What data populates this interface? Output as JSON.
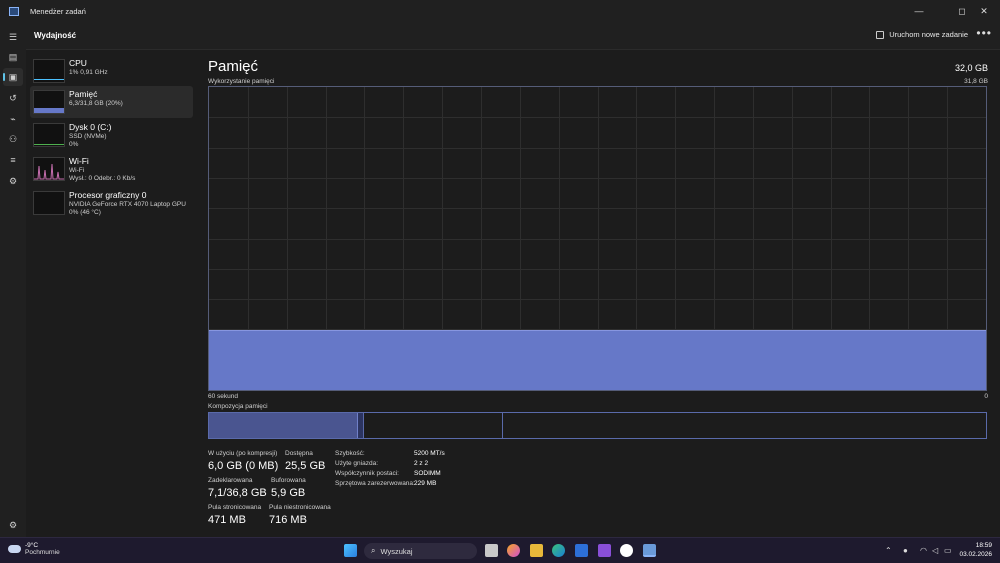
{
  "window": {
    "title": "Menedżer zadań",
    "controls": {
      "minimize": "—",
      "maximize": "◻",
      "close": "✕"
    }
  },
  "header": {
    "page_title": "Wydajność",
    "run_task_label": "Uruchom nowe zadanie",
    "more_label": "•••"
  },
  "nav": {
    "items": [
      {
        "icon": "hamburger-icon",
        "glyph": "☰"
      },
      {
        "icon": "processes-icon",
        "glyph": "▤"
      },
      {
        "icon": "performance-icon",
        "glyph": "▣"
      },
      {
        "icon": "app-history-icon",
        "glyph": "↺"
      },
      {
        "icon": "startup-apps-icon",
        "glyph": "⌁"
      },
      {
        "icon": "users-icon",
        "glyph": "⚇"
      },
      {
        "icon": "details-icon",
        "glyph": "≡"
      },
      {
        "icon": "services-icon",
        "glyph": "⚙"
      }
    ],
    "settings_glyph": "⚙"
  },
  "sidebar": {
    "items": [
      {
        "name": "CPU",
        "sub1": "1% 0,91 GHz",
        "sub2": ""
      },
      {
        "name": "Pamięć",
        "sub1": "6,3/31,8 GB (20%)",
        "sub2": ""
      },
      {
        "name": "Dysk 0 (C:)",
        "sub1": "SSD (NVMe)",
        "sub2": "0%"
      },
      {
        "name": "Wi-Fi",
        "sub1": "Wi-Fi",
        "sub2": "Wysł.: 0 Odebr.: 0 Kb/s"
      },
      {
        "name": "Procesor graficzny 0",
        "sub1": "NVIDIA GeForce RTX 4070 Laptop GPU",
        "sub2": "0% (46 °C)"
      }
    ]
  },
  "main": {
    "title": "Pamięć",
    "total": "32,0 GB",
    "chart_label": "Wykorzystanie pamięci",
    "chart_max": "31,8 GB",
    "axis_left": "60 sekund",
    "axis_right": "0",
    "usage_fraction": 0.198,
    "composition_label": "Kompozycja pamięci",
    "composition": {
      "in_use_fraction": 0.19,
      "modified_fraction": 0.008,
      "standby_fraction": 0.18
    },
    "stats": {
      "in_use_label": "W użyciu (po kompresji)",
      "in_use_value": "6,0 GB (0 MB)",
      "available_label": "Dostępna",
      "available_value": "25,5 GB",
      "committed_label": "Zadeklarowana",
      "committed_value": "7,1/36,8 GB",
      "cached_label": "Buforowana",
      "cached_value": "5,9 GB",
      "paged_label": "Pula stronicowana",
      "paged_value": "471 MB",
      "nonpaged_label": "Pula niestronicowana",
      "nonpaged_value": "716 MB"
    },
    "props": [
      {
        "k": "Szybkość:",
        "v": "5200 MT/s"
      },
      {
        "k": "Użyte gniazda:",
        "v": "2 z 2"
      },
      {
        "k": "Współczynnik postaci:",
        "v": "SODIMM"
      },
      {
        "k": "Sprzętowa zarezerwowana:",
        "v": "229 MB"
      }
    ]
  },
  "taskbar": {
    "temp": "-9°C",
    "condition": "Pochmurnie",
    "search_placeholder": "Wyszukaj",
    "time": "18:59",
    "date": "03.02.2026"
  },
  "colors": {
    "memory_fill": "#6678c8",
    "accent": "#5ec3e8"
  }
}
